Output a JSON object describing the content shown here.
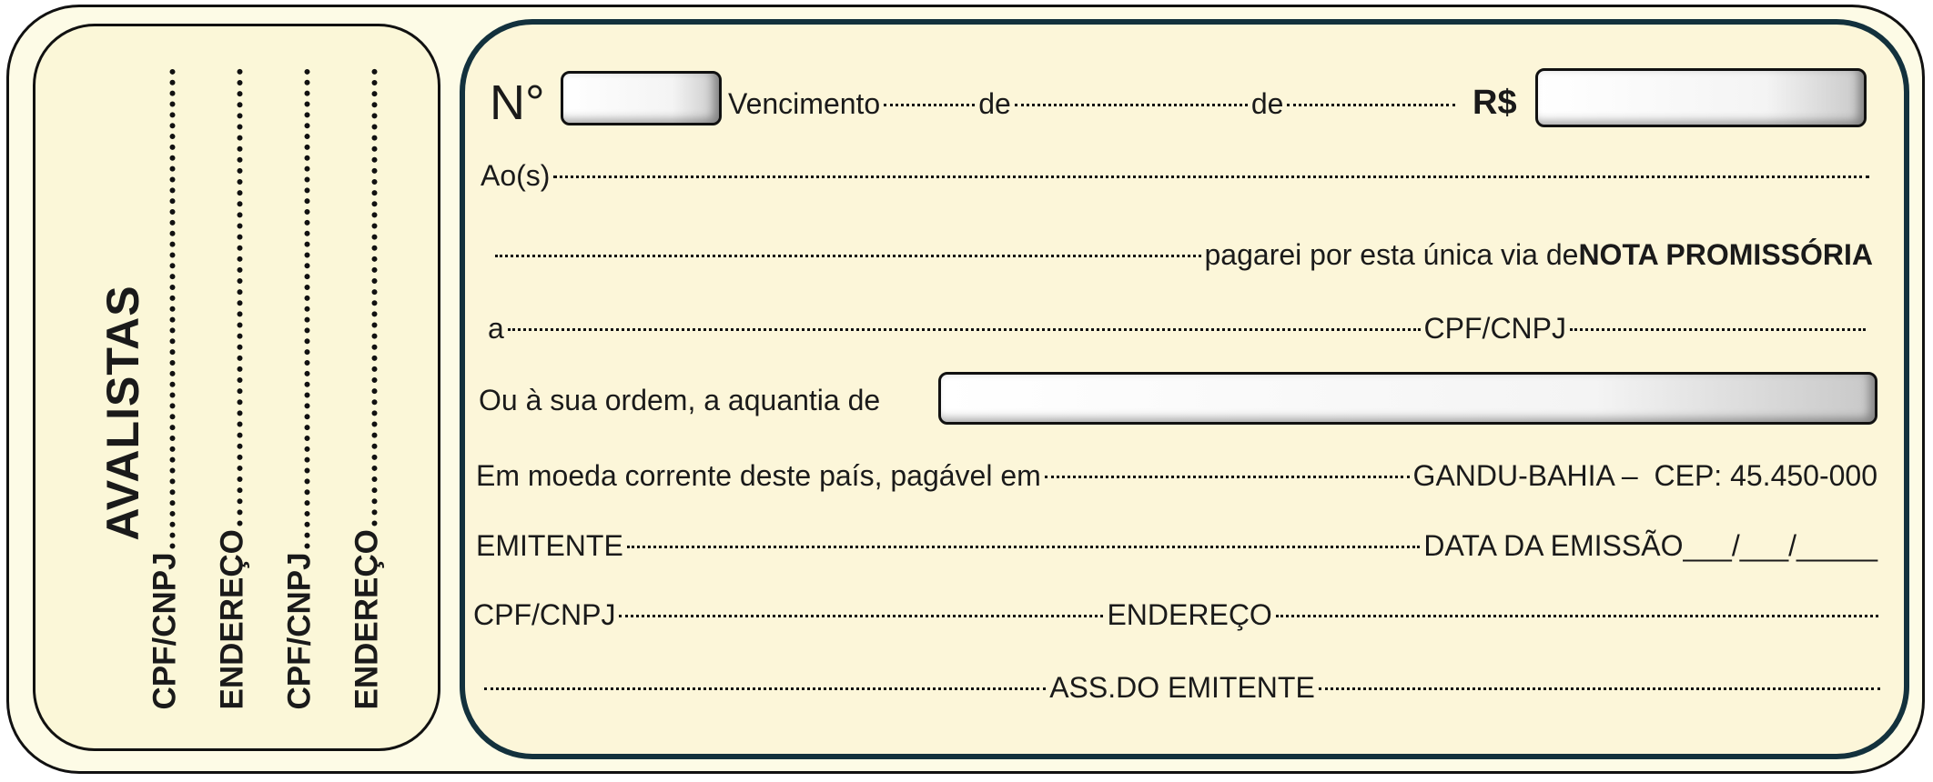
{
  "avalistas": {
    "title": "AVALISTAS",
    "lines": [
      "CPF/CNPJ",
      "ENDEREÇO",
      "CPF/CNPJ",
      "ENDEREÇO"
    ]
  },
  "note": {
    "numero_label": "N°",
    "vencimento_label": "Vencimento",
    "de1": "de",
    "de2": "de",
    "valor_label": "R$",
    "aos_label": "Ao(s)",
    "pagarei_text": "pagarei por esta única via de ",
    "nota_title": "NOTA PROMISSÓRIA",
    "a_label": "a",
    "cpf_cnpj_label": "CPF/CNPJ",
    "quantia_label": "Ou à sua ordem, a aquantia de",
    "moeda_text": "Em moeda corrente deste país, pagável em",
    "cidade": "GANDU-BAHIA –  CEP: 45.450-000",
    "emitente_label": "EMITENTE",
    "data_emissao": "DATA DA EMISSÃO___/___/_____",
    "cpf_cnpj_label2": "CPF/CNPJ",
    "endereco_label": "ENDEREÇO",
    "ass_label": "ASS.DO EMITENTE"
  }
}
